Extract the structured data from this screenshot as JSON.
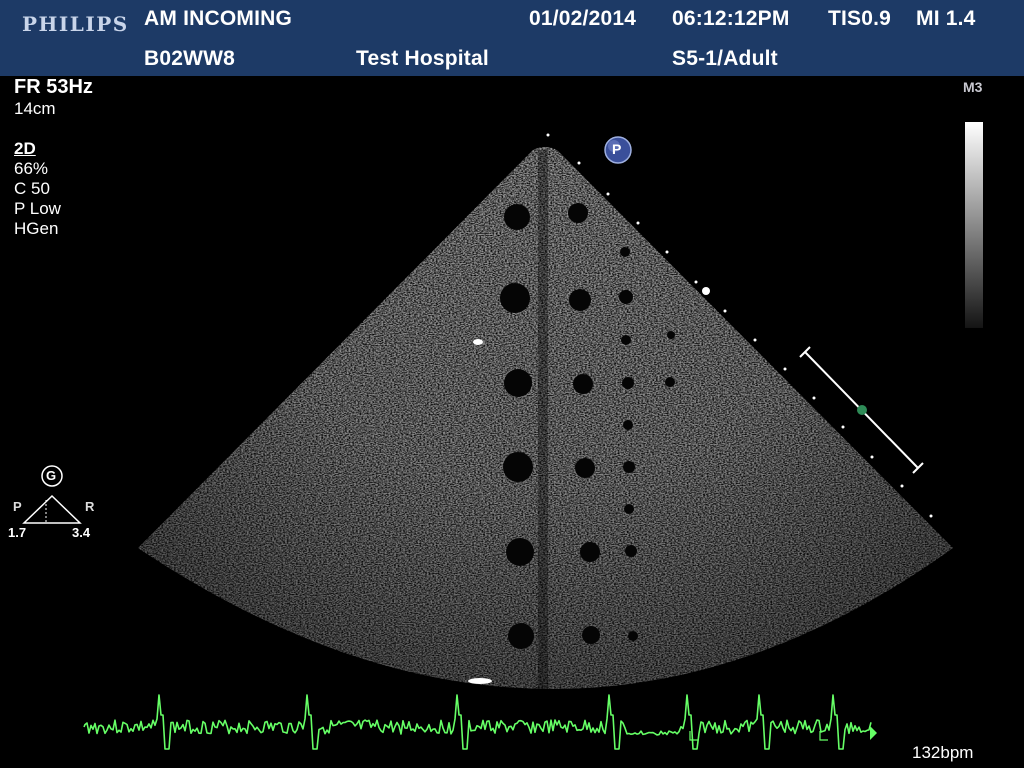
{
  "header": {
    "brand": "PHILIPS",
    "patient_name": "AM INCOMING",
    "date": "01/02/2014",
    "time": "06:12:12PM",
    "tis": "TIS0.9",
    "mi": "MI 1.4",
    "patient_id": "B02WW8",
    "hospital": "Test Hospital",
    "transducer": "S5-1/Adult"
  },
  "params": {
    "frame_rate": "FR 53Hz",
    "depth": "14cm",
    "mode": "2D",
    "gain": " 66%",
    "compress": "C 50",
    "power": "P Low",
    "freq": "HGen"
  },
  "grayscale": {
    "map_label": "M3"
  },
  "orientation": {
    "marker": "P"
  },
  "trapezoid": {
    "label": "G",
    "left": "P",
    "right": "R",
    "left_value": "1.7",
    "right_value": "3.4"
  },
  "ecg": {
    "heart_rate": "132bpm",
    "trace_color": "#66ff66"
  },
  "colors": {
    "header_bg": "#1d3a66",
    "focus_marker": "#2e8b57"
  }
}
